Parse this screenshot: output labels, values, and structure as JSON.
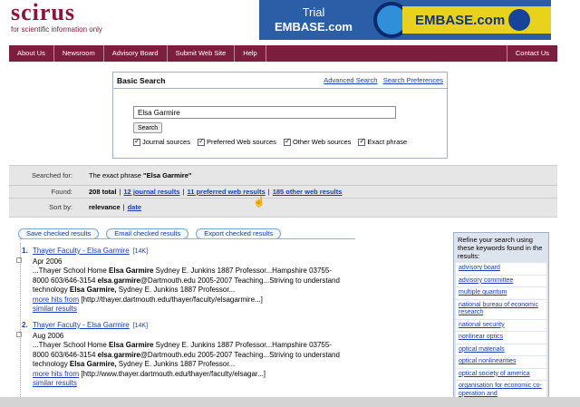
{
  "logo": {
    "name": "scirus",
    "tagline": "for scientific information only"
  },
  "banner": {
    "line1": "Trial",
    "line2": "EMBASE.com",
    "brand": "EMBASE.com"
  },
  "nav": {
    "items": [
      "About Us",
      "Newsroom",
      "Advisory Board",
      "Submit Web Site",
      "Help"
    ],
    "right": "Contact Us"
  },
  "search": {
    "title": "Basic Search",
    "advanced_link": "Advanced Search",
    "prefs_link": "Search Preferences",
    "query": "Elsa Garmire",
    "button": "Search",
    "checks": [
      "Journal sources",
      "Preferred Web sources",
      "Other Web sources",
      "Exact phrase"
    ]
  },
  "summary": {
    "searched_label": "Searched for:",
    "searched_prefix": "The exact phrase",
    "searched_value": "\"Elsa Garmire\"",
    "found_label": "Found:",
    "found_total": "208 total",
    "journal_results": "12 journal results",
    "preferred_results": "11 preferred web results",
    "other_results": "185 other web results",
    "sort_label": "Sort by:",
    "sort_relevance": "relevance",
    "sort_date": "date"
  },
  "actions": {
    "save": "Save checked results",
    "email": "Email checked results",
    "export": "Export checked results"
  },
  "results": [
    {
      "num": "1.",
      "title": "Thayer Faculty - Elsa Garmire",
      "size": "[14K]",
      "date": "Apr 2006",
      "snippet1_a": "...Thayer School Home ",
      "snippet1_b": "Elsa Garmire",
      "snippet1_c": " Sydney E. Junkins 1887 Professor...Hampshire 03755-",
      "snippet2_a": "8000 603/646-3154 ",
      "snippet2_b": "elsa",
      "snippet2_c": ".",
      "snippet2_d": "garmire",
      "snippet2_e": "@Dartmouth.edu 2005-2007 Teaching...Striving to understand",
      "snippet3_a": "technology ",
      "snippet3_b": "Elsa Garmire,",
      "snippet3_c": " Sydney E. Junkins 1887 Professor...",
      "more_hits": "more hits from",
      "url": "[http://thayer.dartmouth.edu/thayer/faculty/elsagarmire...]",
      "similar": "similar results"
    },
    {
      "num": "2.",
      "title": "Thayer Faculty - Elsa Garmire",
      "size": "[14K]",
      "date": "Aug 2006",
      "snippet1_a": "...Thayer School Home ",
      "snippet1_b": "Elsa Garmire",
      "snippet1_c": " Sydney E. Junkins 1887 Professor...Hampshire 03755-",
      "snippet2_a": "8000 603/646-3154 ",
      "snippet2_b": "elsa",
      "snippet2_c": ".",
      "snippet2_d": "garmire",
      "snippet2_e": "@Dartmouth.edu 2005-2007 Teaching...Striving to understand",
      "snippet3_a": "technology ",
      "snippet3_b": "Elsa Garmire,",
      "snippet3_c": " Sydney E. Junkins 1887 Professor...",
      "more_hits": "more hits from",
      "url": "[http://www.thayer.dartmouth.edu/thayer/faculty/elsagar...]",
      "similar": "similar results"
    }
  ],
  "refine": {
    "heading": "Refine your search using these keywords found in the results:",
    "keywords": [
      "advisory board",
      "advisory committee",
      "multiple quantum",
      "national bureau of economic research",
      "national security",
      "nonlinear optics",
      "optical materials",
      "optical nonlinearities",
      "optical society of america",
      "organisation for economic co-operation and"
    ]
  }
}
